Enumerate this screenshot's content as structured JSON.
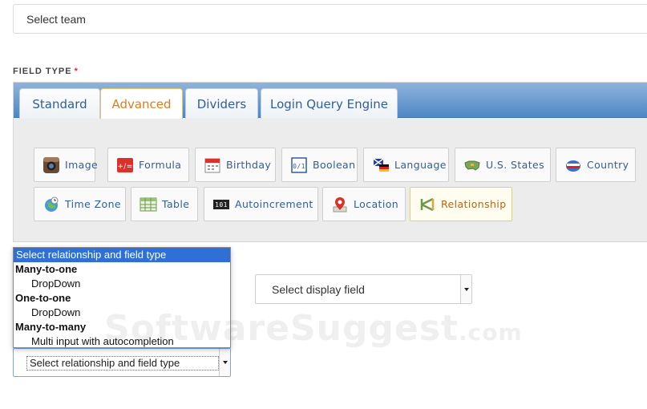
{
  "team_select": {
    "placeholder": "Select team"
  },
  "field_type": {
    "label": "FIELD TYPE",
    "required_mark": "*"
  },
  "tabs": [
    {
      "label": "Standard",
      "active": false
    },
    {
      "label": "Advanced",
      "active": true
    },
    {
      "label": "Dividers",
      "active": false
    },
    {
      "label": "Login Query Engine",
      "active": false
    }
  ],
  "types": [
    {
      "label": "Image",
      "icon": "instagram-camera-icon"
    },
    {
      "label": "Formula",
      "icon": "formula-icon"
    },
    {
      "label": "Birthday",
      "icon": "calendar-icon"
    },
    {
      "label": "Boolean",
      "icon": "boolean-icon"
    },
    {
      "label": "Language",
      "icon": "language-flags-icon"
    },
    {
      "label": "U.S. States",
      "icon": "us-map-icon"
    },
    {
      "label": "Country",
      "icon": "country-flag-icon"
    },
    {
      "label": "Time Zone",
      "icon": "globe-clock-icon"
    },
    {
      "label": "Table",
      "icon": "table-icon"
    },
    {
      "label": "Autoincrement",
      "icon": "counter-icon"
    },
    {
      "label": "Location",
      "icon": "map-pin-icon"
    },
    {
      "label": "Relationship",
      "icon": "relationship-icon",
      "selected": true
    }
  ],
  "relationship_dropdown": {
    "highlighted": "Select relationship and field type",
    "groups": [
      {
        "label": "Many-to-one",
        "options": [
          "DropDown"
        ]
      },
      {
        "label": "One-to-one",
        "options": [
          "DropDown"
        ]
      },
      {
        "label": "Many-to-many",
        "options": [
          "Multi input with autocompletion"
        ]
      }
    ],
    "selected_value": "Select relationship and field type"
  },
  "display_select": {
    "placeholder": "Select display field"
  },
  "watermark": {
    "text": "SoftwareSuggest",
    "suffix": ".com"
  },
  "colors": {
    "tab_bar": "#4f87c4",
    "active_tab_text": "#e07d18",
    "link_blue": "#2f5f97",
    "highlight": "#2f70d8",
    "required": "#d9302c"
  }
}
